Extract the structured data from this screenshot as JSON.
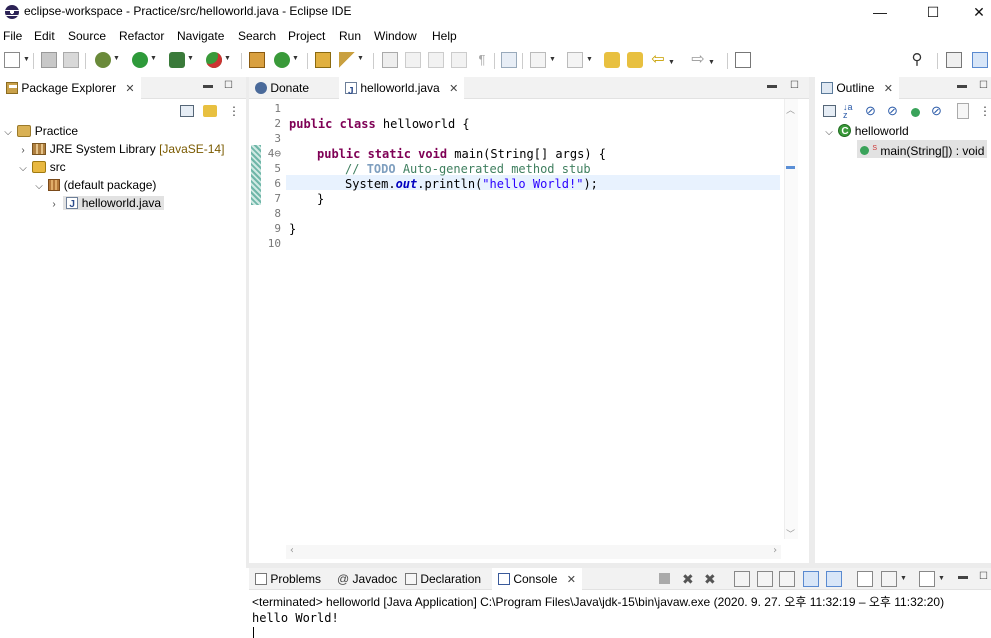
{
  "window": {
    "title": "eclipse-workspace - Practice/src/helloworld.java - Eclipse IDE",
    "minimize": "—",
    "maximize": "☐",
    "close": "✕"
  },
  "menu": [
    "File",
    "Edit",
    "Source",
    "Refactor",
    "Navigate",
    "Search",
    "Project",
    "Run",
    "Window",
    "Help"
  ],
  "toolbar": {
    "icons": [
      "new-icon",
      "save-icon",
      "save-all-icon",
      "debug-icon",
      "run-icon",
      "coverage-icon",
      "external-tools-icon",
      "new-java-project-icon",
      "new-class-icon",
      "open-type-icon",
      "search-icon-tb",
      "mark-occurrences-icon",
      "annotation-next-icon",
      "back-icon",
      "forward-icon",
      "pin-editor-icon",
      "quick-access-search-icon",
      "perspective-icon"
    ]
  },
  "package_explorer": {
    "tab_label": "Package Explorer",
    "tree": {
      "project": "Practice",
      "library": "JRE System Library",
      "library_decor": "[JavaSE-14]",
      "src": "src",
      "package": "(default package)",
      "file": "helloworld.java"
    }
  },
  "editor": {
    "tabs": [
      {
        "label": "Donate"
      },
      {
        "label": "helloworld.java"
      }
    ],
    "line_numbers": [
      "1",
      "2",
      "3",
      "4⊖",
      "5",
      "6",
      "7",
      "8",
      "9",
      "10"
    ],
    "code": {
      "l2_kw": "public class",
      "l2_rest": " helloworld {",
      "l4_kw": "public static void",
      "l4_rest": " main(String[] args) {",
      "l5_prefix": "// ",
      "l5_todo": "TODO",
      "l5_rest": " Auto-generated method stub",
      "l6_a": "System.",
      "l6_field": "out",
      "l6_b": ".println(",
      "l6_str": "\"hello World!\"",
      "l6_c": ");",
      "l7": "}",
      "l9": "}"
    }
  },
  "outline": {
    "tab_label": "Outline",
    "class_name": "helloworld",
    "method": "main(String[]) : void",
    "method_modifier": "S"
  },
  "bottom": {
    "tabs": [
      "Problems",
      "Javadoc",
      "Declaration",
      "Console"
    ],
    "terminated_line": "<terminated> helloworld [Java Application] C:\\Program Files\\Java\\jdk-15\\bin\\javaw.exe  (2020. 9. 27. 오후 11:32:19 – 오후 11:32:20)",
    "output": "hello World!"
  },
  "colors": {
    "keyword": "#7f0055",
    "comment": "#3f7f5f",
    "string": "#2a00ff",
    "field": "#0000c0",
    "current_line": "#e8f2fe"
  }
}
